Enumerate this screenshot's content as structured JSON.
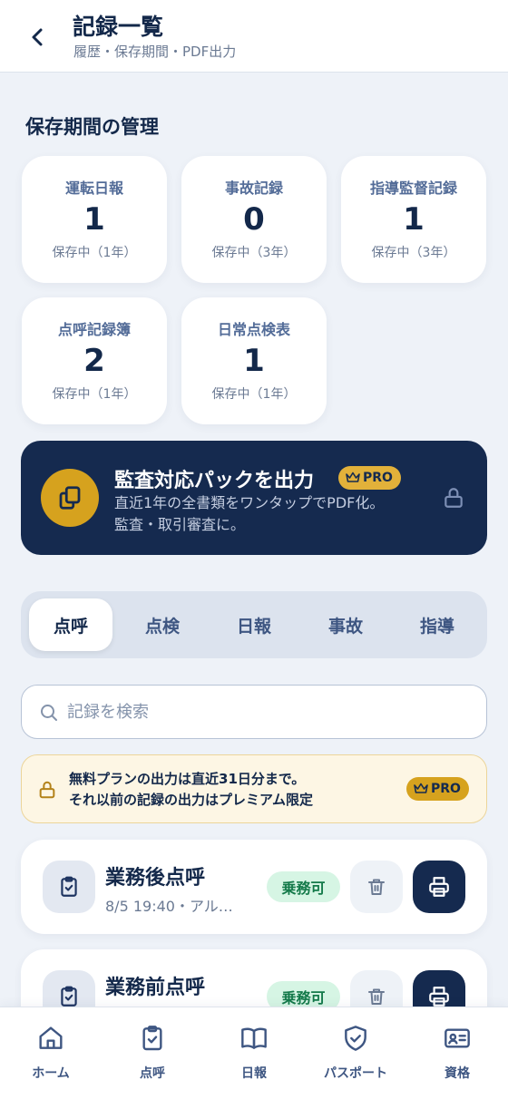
{
  "header": {
    "title": "記録一覧",
    "subtitle": "履歴・保存期間・PDF出力",
    "back_icon": "chevron-left-icon"
  },
  "retention": {
    "section_title": "保存期間の管理",
    "cards": [
      {
        "label": "運転日報",
        "count": "1",
        "status": "保存中（1年）"
      },
      {
        "label": "事故記録",
        "count": "0",
        "status": "保存中（3年）"
      },
      {
        "label": "指導監督記録",
        "count": "1",
        "status": "保存中（3年）"
      },
      {
        "label": "点呼記録簿",
        "count": "2",
        "status": "保存中（1年）"
      },
      {
        "label": "日常点検表",
        "count": "1",
        "status": "保存中（1年）"
      }
    ]
  },
  "audit_pack": {
    "title": "監査対応パックを出力",
    "badge": "PRO",
    "description_line1": "直近1年の全書類をワンタップでPDF化。",
    "description_line2": "監査・取引審査に。",
    "icon": "copy-documents-icon",
    "lock_icon": "lock-icon"
  },
  "tabs": [
    {
      "label": "点呼",
      "active": true
    },
    {
      "label": "点検",
      "active": false
    },
    {
      "label": "日報",
      "active": false
    },
    {
      "label": "事故",
      "active": false
    },
    {
      "label": "指導",
      "active": false
    }
  ],
  "search": {
    "placeholder": "記録を検索",
    "value": ""
  },
  "free_notice": {
    "line1": "無料プランの出力は直近31日分まで。",
    "line2": "それ以前の記録の出力はプレミアム限定",
    "badge": "PRO"
  },
  "records": [
    {
      "title": "業務後点呼",
      "meta": "8/5 19:40・アル…",
      "status": "乗務可"
    },
    {
      "title": "業務前点呼",
      "meta": "",
      "status": "乗務可"
    }
  ],
  "bottom_nav": [
    {
      "label": "ホーム",
      "icon": "home-icon"
    },
    {
      "label": "点呼",
      "icon": "clipboard-check-icon"
    },
    {
      "label": "日報",
      "icon": "book-open-icon"
    },
    {
      "label": "パスポート",
      "icon": "shield-check-icon"
    },
    {
      "label": "資格",
      "icon": "id-card-icon"
    }
  ],
  "colors": {
    "navy": "#152a4f",
    "gold": "#d6a21e",
    "success_bg": "#d6f5e4",
    "success_text": "#147a4a",
    "background": "#eef2f8"
  }
}
